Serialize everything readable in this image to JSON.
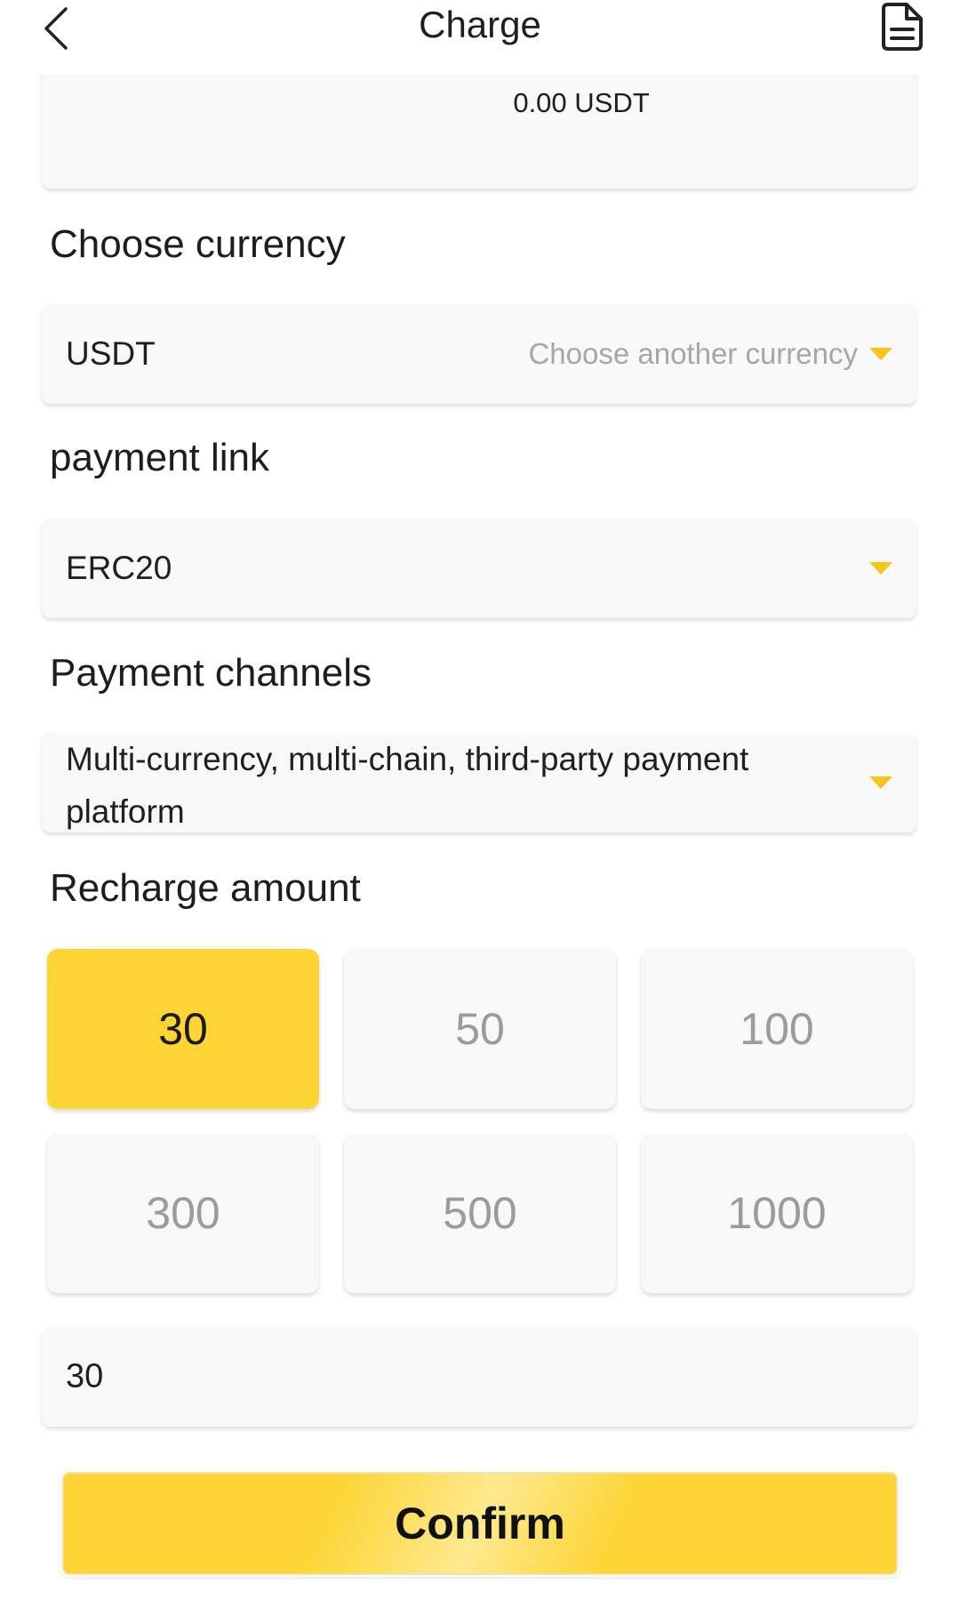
{
  "header": {
    "title": "Charge",
    "back_icon": "chevron-left-icon",
    "records_icon": "document-icon"
  },
  "balance": {
    "value": "0.00 USDT"
  },
  "currency": {
    "label": "Choose currency",
    "value": "USDT",
    "hint": "Choose another currency"
  },
  "payment_link": {
    "label": "payment link",
    "value": "ERC20"
  },
  "payment_channels": {
    "label": "Payment channels",
    "value": "Multi-currency, multi-chain, third-party payment platform"
  },
  "recharge": {
    "label": "Recharge amount",
    "options": [
      "30",
      "50",
      "100",
      "300",
      "500",
      "1000"
    ],
    "selected": "30",
    "input_value": "30"
  },
  "confirm_label": "Confirm",
  "colors": {
    "accent": "#fcd535",
    "caret": "#f5c518",
    "card_bg": "#f8f8f8",
    "muted_text": "#9b9b9b"
  }
}
